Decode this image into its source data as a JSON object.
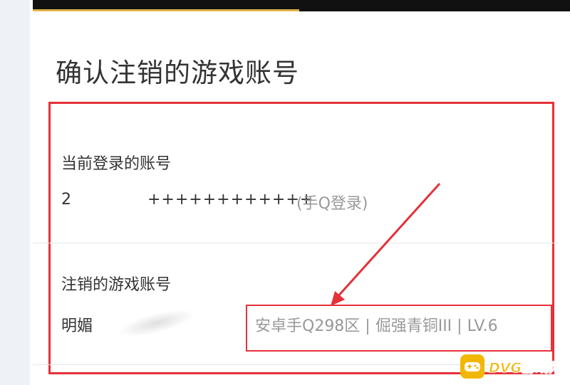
{
  "header": {
    "title": "确认注销的游戏账号"
  },
  "current_account": {
    "label": "当前登录的账号",
    "id_prefix": "2",
    "masked_id": "++++++++++++",
    "login_method": "(手Q登录)"
  },
  "cancel_account": {
    "label": "注销的游戏账号",
    "role_name": "明媚",
    "server_info": "安卓手Q298区 | 倔强青铜III | LV.6"
  },
  "watermark": {
    "text": "DVG游戏网"
  },
  "colors": {
    "annotation_red": "#e5313a",
    "accent_gold": "#e0b34a",
    "watermark_yellow": "#f2b705"
  }
}
